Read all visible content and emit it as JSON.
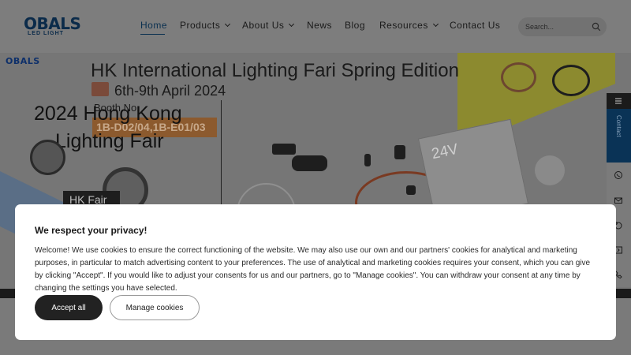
{
  "brand": {
    "logo_main": "OBALS",
    "logo_sub": "LED LIGHT"
  },
  "nav": {
    "items": [
      {
        "label": "Home",
        "has_dropdown": false,
        "active": true
      },
      {
        "label": "Products",
        "has_dropdown": true,
        "active": false
      },
      {
        "label": "About Us",
        "has_dropdown": true,
        "active": false
      },
      {
        "label": "News",
        "has_dropdown": false,
        "active": false
      },
      {
        "label": "Blog",
        "has_dropdown": false,
        "active": false
      },
      {
        "label": "Resources",
        "has_dropdown": true,
        "active": false
      },
      {
        "label": "Contact Us",
        "has_dropdown": false,
        "active": false
      }
    ]
  },
  "search": {
    "placeholder": "Search..."
  },
  "banner": {
    "logo": "OBALS",
    "event_title": "HK International Lighting Fari Spring Edition",
    "event_date": "6th-9th April 2024",
    "booth_label": "Booth No.",
    "booth_number": "1B-D02/04,1B-E01/03",
    "headline_line1": "2024 Hong Kong",
    "headline_line2": "Lighting Fair",
    "fair_tag": "HK Fair",
    "magazine_text": "24V"
  },
  "side_bar": {
    "contact_label": "Contact",
    "icons": [
      "menu-icon",
      "whatsapp-icon",
      "email-icon",
      "skype-icon",
      "share-icon",
      "phone-icon"
    ]
  },
  "cookie": {
    "title": "We respect your privacy!",
    "text": "Welcome! We use cookies to ensure the correct functioning of the website. We may also use our own and our partners' cookies for analytical and marketing purposes, in particular to match advertising content to your preferences. The use of analytical and marketing cookies requires your consent, which you can give by clicking \"Accept\". If you would like to adjust your consents for us and our partners, go to \"Manage cookies\". You can withdraw your consent at any time by changing the settings you have selected.",
    "accept_label": "Accept all",
    "manage_label": "Manage cookies"
  },
  "colors": {
    "overlay_header": "#7d7d7d",
    "accent_navy": "#0a3356",
    "booth_badge": "#8c5a2e",
    "button_dark": "#222222"
  }
}
